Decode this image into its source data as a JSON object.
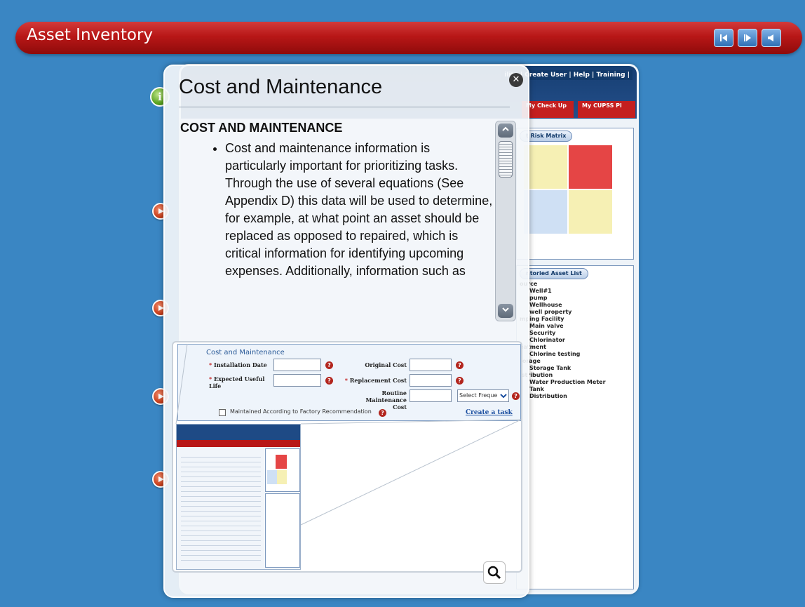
{
  "banner": {
    "title": "Asset Inventory",
    "nav": [
      {
        "name": "previous-button",
        "glyph": "◀"
      },
      {
        "name": "next-button",
        "glyph": "▶"
      },
      {
        "name": "audio-button",
        "glyph": "◀"
      }
    ]
  },
  "app": {
    "topnav": "ility | Create User | Help | Training |",
    "tabs": [
      {
        "label": "My Check Up"
      },
      {
        "label": "My CUPSS Pl"
      }
    ],
    "risk_panel_title": "t Risk Matrix",
    "inventory_panel_title": "ntoried Asset List",
    "inventory": [
      {
        "text": "ource",
        "indent": 0
      },
      {
        "text": "Well#1",
        "indent": 2
      },
      {
        "text": "pump",
        "indent": 2
      },
      {
        "text": "Wellhouse",
        "indent": 2
      },
      {
        "text": "well property",
        "indent": 2
      },
      {
        "text": "mping Facility",
        "indent": 0
      },
      {
        "text": "Main valve",
        "indent": 2
      },
      {
        "text": "Security",
        "indent": 2
      },
      {
        "text": "Chlorinator",
        "indent": 2
      },
      {
        "text": "eatment",
        "indent": 0
      },
      {
        "text": "Chlorine testing",
        "indent": 2
      },
      {
        "text": "torage",
        "indent": 0
      },
      {
        "text": "Storage Tank",
        "indent": 2
      },
      {
        "text": "istribution",
        "indent": 0
      },
      {
        "text": "Water Production Meter",
        "indent": 2
      },
      {
        "text": "Tank",
        "indent": 2
      },
      {
        "text": "Distribution",
        "indent": 2
      }
    ]
  },
  "overlay": {
    "title": "Cost and Maintenance",
    "close_glyph": "✕",
    "heading": "COST AND MAINTENANCE",
    "bullet": "Cost and maintenance information is particularly important for prioritizing tasks.  Through the use of several equations (See Appendix D) this data will be used to determine, for example, at what point an asset should be replaced as opposed to repaired, which is critical information for identifying upcoming expenses.  Additionally, information such as"
  },
  "form": {
    "title": "Cost and Maintenance",
    "installation_date_label": "Installation Date",
    "expected_life_label": "Expected Useful Life",
    "original_cost_label": "Original Cost",
    "replacement_cost_label": "Replacement Cost",
    "routine_cost_label": "Routine Maintenance Cost",
    "frequency_value": "Select Freque",
    "checkbox_label": "Maintained According to Factory Recommendation",
    "create_task_link": "Create a task",
    "required_mark": "*",
    "help_glyph": "?"
  },
  "tools": {
    "magnify_icon": "magnifier-icon"
  },
  "colors": {
    "background": "#3a86c3",
    "banner_red": "#b81717",
    "accent_blue": "#2a5a98",
    "help_red": "#b3261e"
  }
}
